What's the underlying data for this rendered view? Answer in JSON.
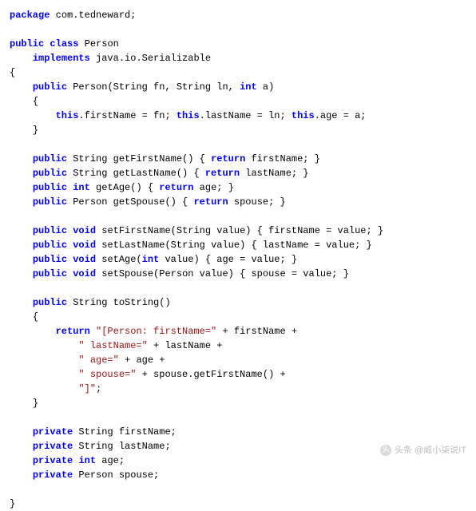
{
  "code": {
    "package_kw": "package",
    "package_name": " com.tedneward;",
    "public_kw": "public",
    "class_kw": "class",
    "class_name": " Person",
    "implements_kw": "implements",
    "implements_type": " java.io.Serializable",
    "brace_open": "{",
    "brace_close": "}",
    "ctor_sig_1": " Person(String fn, String ln, ",
    "int_kw": "int",
    "ctor_sig_2": " a)",
    "this_kw": "this",
    "ctor_body_1": ".firstName = fn; ",
    "ctor_body_2": ".lastName = ln; ",
    "ctor_body_3": ".age = a;",
    "return_kw": "return",
    "void_kw": "void",
    "private_kw": "private",
    "get_fn_sig": " String getFirstName() { ",
    "get_fn_ret": " firstName; }",
    "get_ln_sig": " String getLastName() { ",
    "get_ln_ret": " lastName; }",
    "get_age_sig_1": " ",
    "get_age_sig_2": " getAge() { ",
    "get_age_ret": " age; }",
    "get_sp_sig": " Person getSpouse() { ",
    "get_sp_ret": " spouse; }",
    "set_fn": " setFirstName(String value) { firstName = value; }",
    "set_ln": " setLastName(String value) { lastName = value; }",
    "set_age_1": " setAge(",
    "set_age_2": " value) { age = value; }",
    "set_sp": " setSpouse(Person value) { spouse = value; }",
    "tostr_sig": " String toString()",
    "str_1": "\"[Person: firstName=\"",
    "tostr_1": " + firstName +",
    "str_2": "\" lastName=\"",
    "tostr_2": " + lastName +",
    "str_3": "\" age=\"",
    "tostr_3": " + age +",
    "str_4": "\" spouse=\"",
    "tostr_4": " + spouse.getFirstName() +",
    "str_5": "\"]\"",
    "tostr_5": ";",
    "field_fn": " String firstName;",
    "field_ln": " String lastName;",
    "field_age_1": " ",
    "field_age_2": " age;",
    "field_sp": " Person spouse;"
  },
  "watermark": {
    "text": "头条 @威小柒说IT"
  }
}
